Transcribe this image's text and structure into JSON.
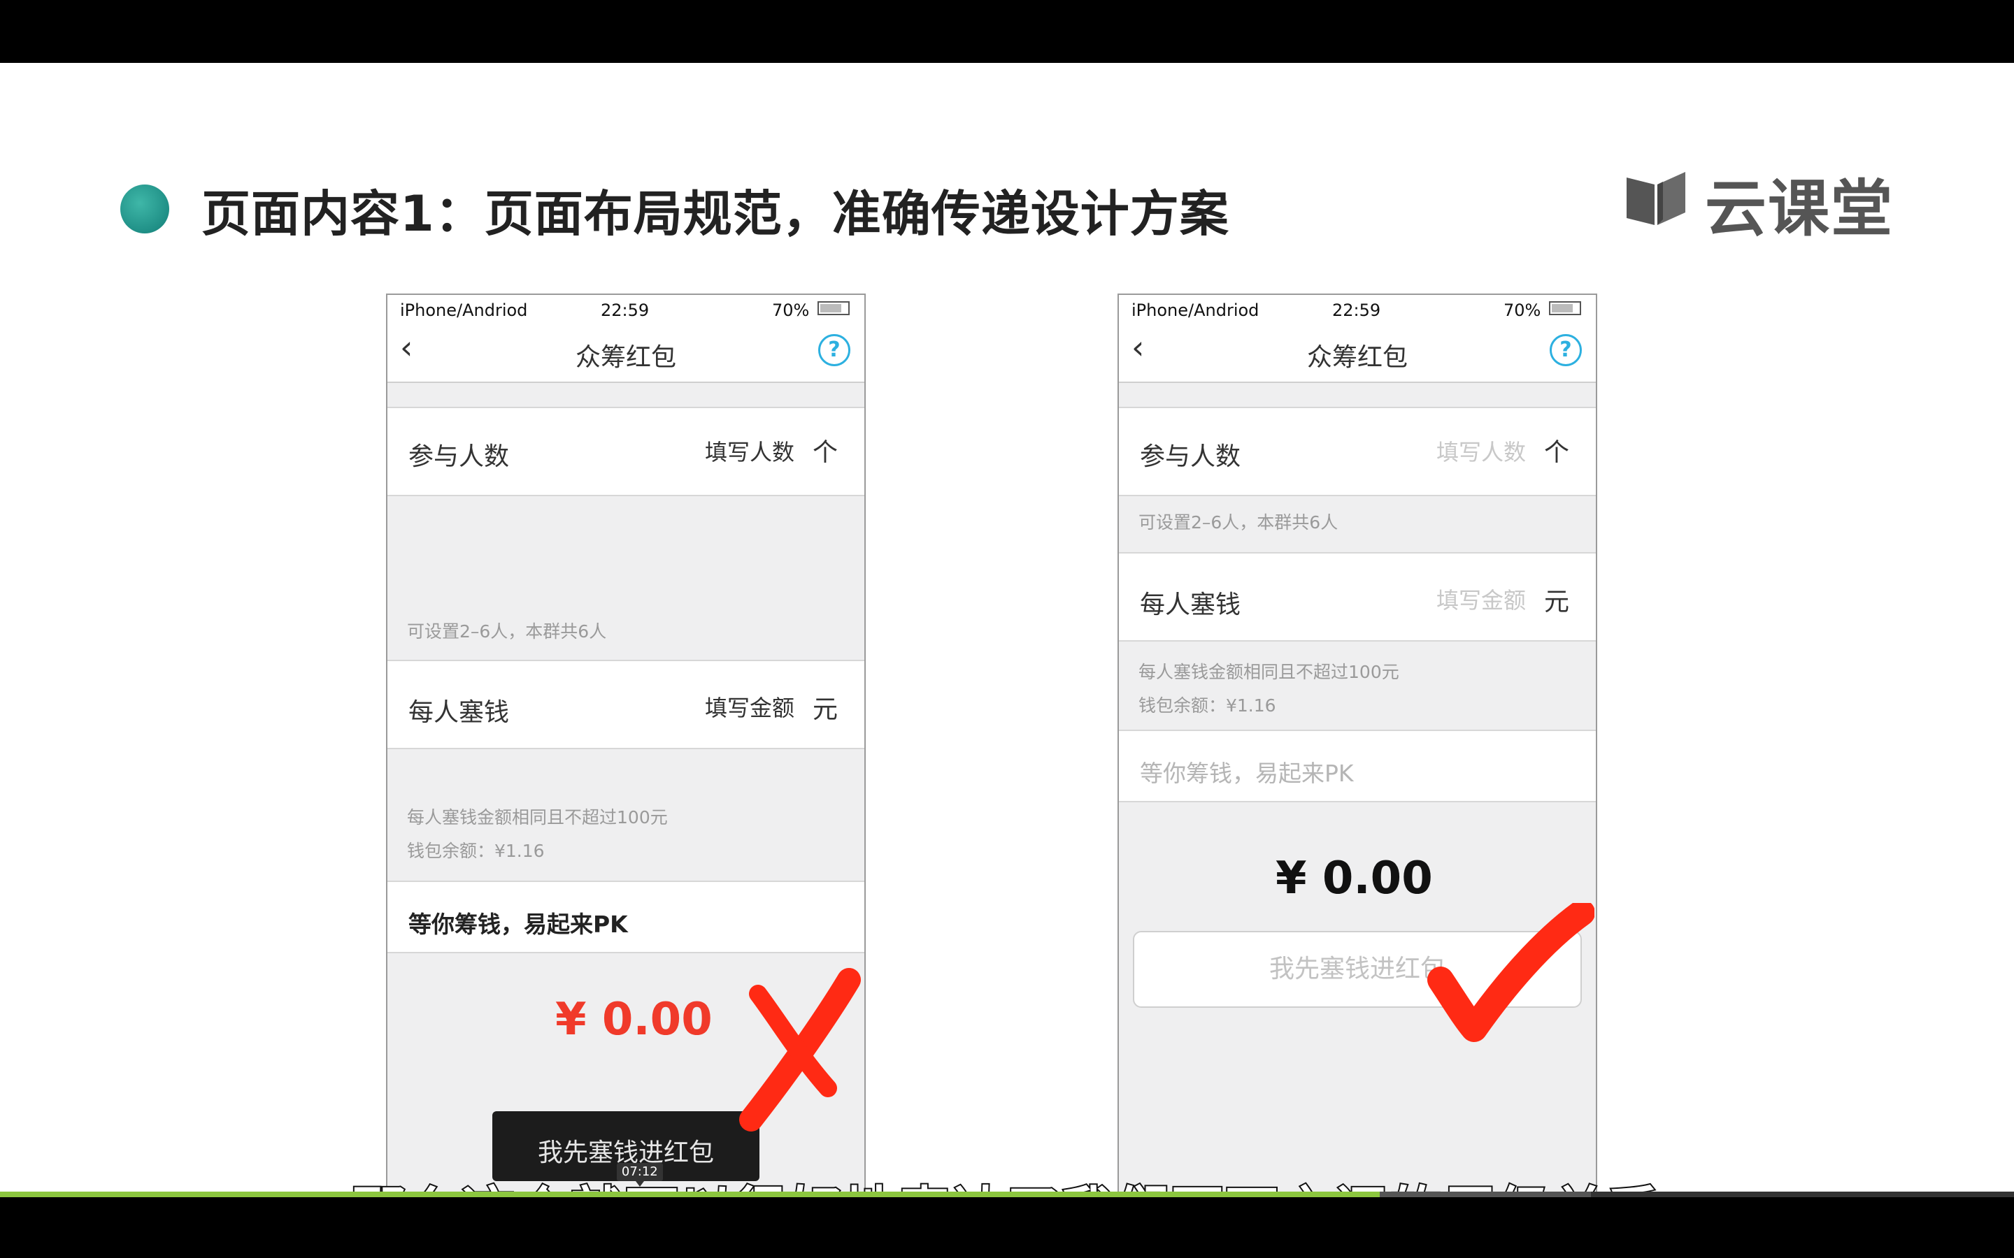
{
  "slide": {
    "heading": "页面内容1：页面布局规范，准确传递设计方案",
    "logo_text": "云课堂"
  },
  "phone_common": {
    "carrier": "iPhone/Andriod",
    "time": "22:59",
    "battery": "70%",
    "back_icon": "chevron-left-icon",
    "title": "众筹红包",
    "help_glyph": "?",
    "field1_label": "参与人数",
    "field1_placeholder": "填写人数",
    "field1_unit": "个",
    "hint_people": "可设置2–6人，本群共6人",
    "field2_label": "每人塞钱",
    "field2_placeholder": "填写金额",
    "field2_unit": "元",
    "hint_amount": "每人塞钱金额相同且不超过100元",
    "hint_balance": "钱包余额：¥1.16",
    "note": "等你筹钱，易起来PK",
    "amount": "¥ 0.00",
    "button_label": "我先塞钱进红包"
  },
  "marks": {
    "wrong_icon": "cross-mark-icon",
    "right_icon": "check-mark-icon",
    "wrong_color": "#ff2a14",
    "right_color": "#ff2a14"
  },
  "colors": {
    "amount_red": "#f03a2a",
    "help_blue": "#2cb0e0",
    "teal_bullet": "#1f8f86",
    "progress_green": "#8cc63f"
  },
  "video": {
    "subtitle": "那么这个就可以很好地表达了我们页面之间的层级关系",
    "current_time": "07:12",
    "progress_fraction": 0.685,
    "buffered_fraction": 0.79
  }
}
